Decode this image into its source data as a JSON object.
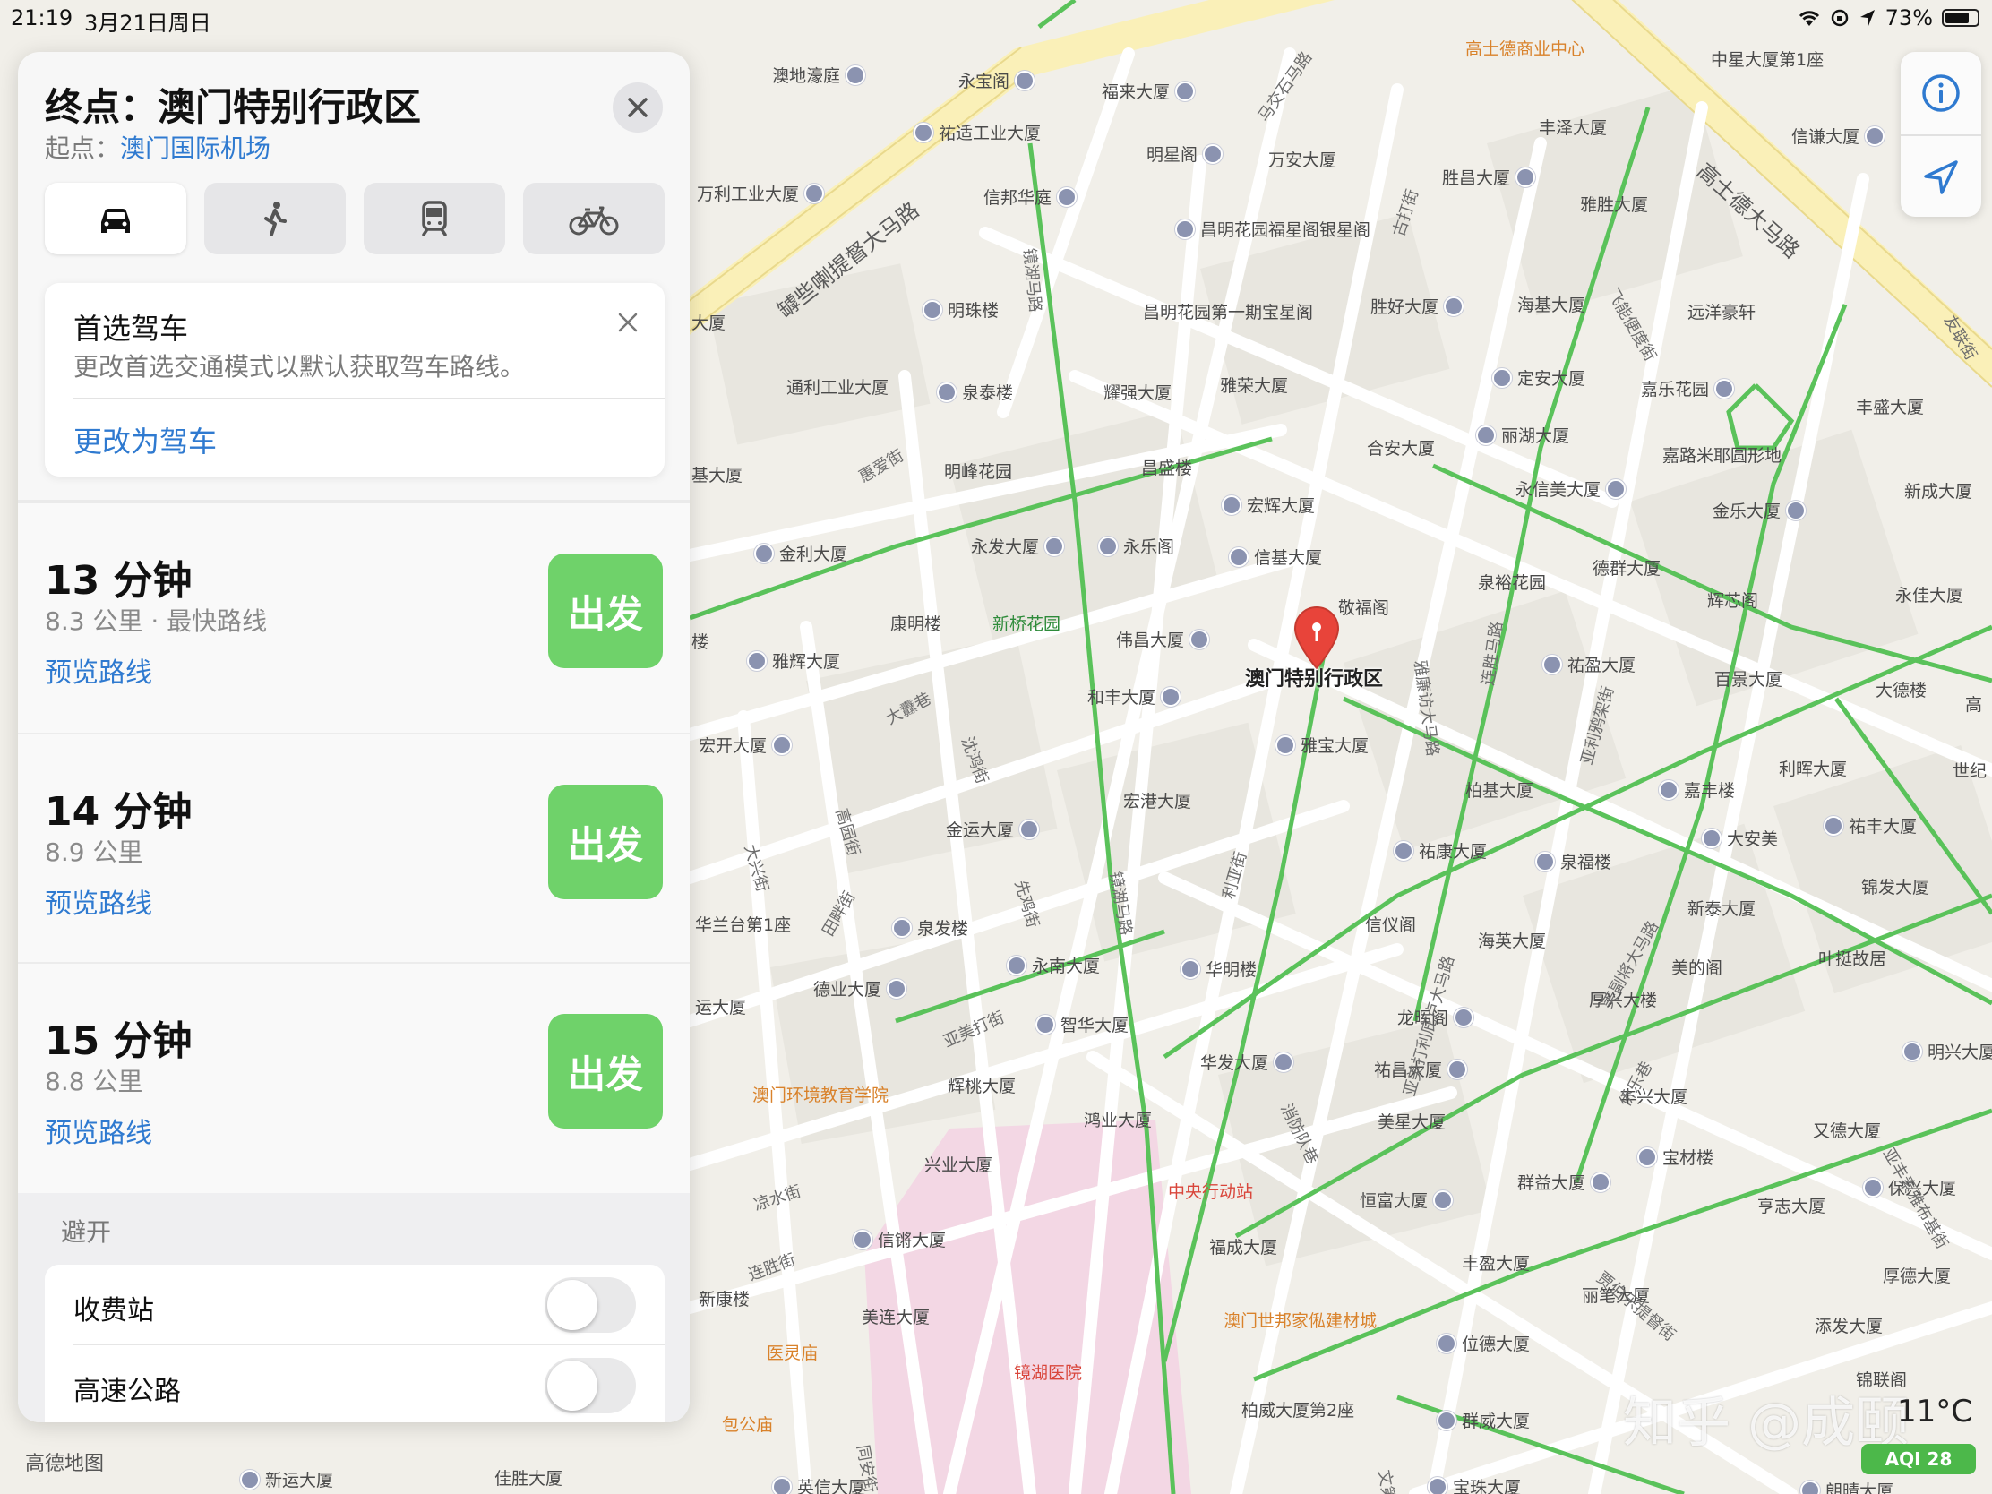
{
  "status_bar": {
    "time": "21:19",
    "date": "3月21日周日",
    "battery": "73%"
  },
  "panel": {
    "title": "终点：澳门特别行政区",
    "origin_prefix": "起点：",
    "origin": "澳门国际机场",
    "modes": [
      {
        "name": "car-icon",
        "active": true
      },
      {
        "name": "walk-icon",
        "active": false
      },
      {
        "name": "transit-icon",
        "active": false
      },
      {
        "name": "bike-icon",
        "active": false
      }
    ],
    "preference": {
      "title": "首选驾车",
      "description": "更改首选交通模式以默认获取驾车路线。",
      "action": "更改为驾车"
    },
    "routes": [
      {
        "minutes": "13 分钟",
        "distance": "8.3 公里 · 最快路线",
        "go": "出发",
        "preview": "预览路线"
      },
      {
        "minutes": "14 分钟",
        "distance": "8.9 公里",
        "go": "出发",
        "preview": "预览路线"
      },
      {
        "minutes": "15 分钟",
        "distance": "8.8 公里",
        "go": "出发",
        "preview": "预览路线"
      }
    ],
    "avoid": {
      "label": "避开",
      "options": [
        {
          "label": "收费站",
          "on": false
        },
        {
          "label": "高速公路",
          "on": false
        }
      ]
    }
  },
  "map": {
    "destination_label": "澳门特别行政区",
    "provider": "高德地图",
    "temperature": "11°C",
    "aqi": "AQI 28",
    "watermark": "知乎 @成颐",
    "pois": [
      {
        "name": "高士德商业中心",
        "kind": "orange"
      },
      {
        "name": "中星大厦第1座",
        "kind": "plain"
      },
      {
        "name": "澳地濠庭",
        "kind": "plain"
      },
      {
        "name": "永宝阁",
        "kind": "plain"
      },
      {
        "name": "福来大厦",
        "kind": "plain"
      },
      {
        "name": "丰泽大厦",
        "kind": "plain"
      },
      {
        "name": "信谦大厦",
        "kind": "plain"
      },
      {
        "name": "祐适工业大厦",
        "kind": "plain"
      },
      {
        "name": "明星阁",
        "kind": "plain"
      },
      {
        "name": "万安大厦",
        "kind": "plain"
      },
      {
        "name": "胜昌大厦",
        "kind": "plain"
      },
      {
        "name": "万利工业大厦",
        "kind": "plain"
      },
      {
        "name": "信邦华庭",
        "kind": "plain"
      },
      {
        "name": "雅胜大厦",
        "kind": "plain"
      },
      {
        "name": "昌明花园福星阁银星阁",
        "kind": "plain"
      },
      {
        "name": "明珠楼",
        "kind": "plain"
      },
      {
        "name": "昌明花园第一期宝星阁",
        "kind": "plain"
      },
      {
        "name": "胜好大厦",
        "kind": "plain"
      },
      {
        "name": "海基大厦",
        "kind": "plain"
      },
      {
        "name": "远洋豪轩",
        "kind": "plain"
      },
      {
        "name": "通利工业大厦",
        "kind": "plain"
      },
      {
        "name": "泉泰楼",
        "kind": "plain"
      },
      {
        "name": "耀强大厦",
        "kind": "plain"
      },
      {
        "name": "雅荣大厦",
        "kind": "plain"
      },
      {
        "name": "定安大厦",
        "kind": "plain"
      },
      {
        "name": "嘉乐花园",
        "kind": "plain"
      },
      {
        "name": "丰盛大厦",
        "kind": "plain"
      },
      {
        "name": "明峰花园",
        "kind": "plain"
      },
      {
        "name": "合安大厦",
        "kind": "plain"
      },
      {
        "name": "丽湖大厦",
        "kind": "plain"
      },
      {
        "name": "嘉路米耶圆形地",
        "kind": "plain"
      },
      {
        "name": "昌盛楼",
        "kind": "plain"
      },
      {
        "name": "永信美大厦",
        "kind": "plain"
      },
      {
        "name": "新成大厦",
        "kind": "plain"
      },
      {
        "name": "宏辉大厦",
        "kind": "plain"
      },
      {
        "name": "金乐大厦",
        "kind": "plain"
      },
      {
        "name": "金利大厦",
        "kind": "plain"
      },
      {
        "name": "永发大厦",
        "kind": "plain"
      },
      {
        "name": "永乐阁",
        "kind": "plain"
      },
      {
        "name": "信基大厦",
        "kind": "plain"
      },
      {
        "name": "德群大厦",
        "kind": "plain"
      },
      {
        "name": "永佳大厦",
        "kind": "plain"
      },
      {
        "name": "康明楼",
        "kind": "plain"
      },
      {
        "name": "新桥花园",
        "kind": "green"
      },
      {
        "name": "敬福阁",
        "kind": "plain"
      },
      {
        "name": "泉裕花园",
        "kind": "plain"
      },
      {
        "name": "辉芯阁",
        "kind": "plain"
      },
      {
        "name": "雅辉大厦",
        "kind": "plain"
      },
      {
        "name": "伟昌大厦",
        "kind": "plain"
      },
      {
        "name": "祐盈大厦",
        "kind": "plain"
      },
      {
        "name": "百景大厦",
        "kind": "plain"
      },
      {
        "name": "大德楼",
        "kind": "plain"
      },
      {
        "name": "和丰大厦",
        "kind": "plain"
      },
      {
        "name": "宏开大厦",
        "kind": "plain"
      },
      {
        "name": "雅宝大厦",
        "kind": "plain"
      },
      {
        "name": "柏基大厦",
        "kind": "plain"
      },
      {
        "name": "嘉丰楼",
        "kind": "plain"
      },
      {
        "name": "利晖大厦",
        "kind": "plain"
      },
      {
        "name": "宏港大厦",
        "kind": "plain"
      },
      {
        "name": "金运大厦",
        "kind": "plain"
      },
      {
        "name": "祐康大厦",
        "kind": "plain"
      },
      {
        "name": "泉福楼",
        "kind": "plain"
      },
      {
        "name": "大安美",
        "kind": "plain"
      },
      {
        "name": "祐丰大厦",
        "kind": "plain"
      },
      {
        "name": "锦发大厦",
        "kind": "plain"
      },
      {
        "name": "信仪阁",
        "kind": "plain"
      },
      {
        "name": "新泰大厦",
        "kind": "plain"
      },
      {
        "name": "海英大厦",
        "kind": "plain"
      },
      {
        "name": "华兰台第1座",
        "kind": "plain"
      },
      {
        "name": "泉发楼",
        "kind": "plain"
      },
      {
        "name": "华明楼",
        "kind": "plain"
      },
      {
        "name": "叶挺故居",
        "kind": "plain"
      },
      {
        "name": "美的阁",
        "kind": "plain"
      },
      {
        "name": "德业大厦",
        "kind": "plain"
      },
      {
        "name": "永南大厦",
        "kind": "plain"
      },
      {
        "name": "厚兴大楼",
        "kind": "plain"
      },
      {
        "name": "智华大厦",
        "kind": "plain"
      },
      {
        "name": "龙晖阁",
        "kind": "plain"
      },
      {
        "name": "明兴大厦",
        "kind": "plain"
      },
      {
        "name": "华发大厦",
        "kind": "plain"
      },
      {
        "name": "祐昌大厦",
        "kind": "plain"
      },
      {
        "name": "澳门环境教育学院",
        "kind": "orange"
      },
      {
        "name": "辉桃大厦",
        "kind": "plain"
      },
      {
        "name": "丰兴大厦",
        "kind": "plain"
      },
      {
        "name": "鸿业大厦",
        "kind": "plain"
      },
      {
        "name": "美星大厦",
        "kind": "plain"
      },
      {
        "name": "又德大厦",
        "kind": "plain"
      },
      {
        "name": "兴业大厦",
        "kind": "plain"
      },
      {
        "name": "宝材楼",
        "kind": "plain"
      },
      {
        "name": "中央行动站",
        "kind": "red"
      },
      {
        "name": "群益大厦",
        "kind": "plain"
      },
      {
        "name": "亨志大厦",
        "kind": "plain"
      },
      {
        "name": "保兴大厦",
        "kind": "plain"
      },
      {
        "name": "恒富大厦",
        "kind": "plain"
      },
      {
        "name": "信锵大厦",
        "kind": "plain"
      },
      {
        "name": "福成大厦",
        "kind": "plain"
      },
      {
        "name": "丰盈大厦",
        "kind": "plain"
      },
      {
        "name": "丽笔大厦",
        "kind": "plain"
      },
      {
        "name": "厚德大厦",
        "kind": "plain"
      },
      {
        "name": "新康楼",
        "kind": "plain"
      },
      {
        "name": "美连大厦",
        "kind": "plain"
      },
      {
        "name": "澳门世邦家俬建材城",
        "kind": "orange"
      },
      {
        "name": "添发大厦",
        "kind": "plain"
      },
      {
        "name": "医灵庙",
        "kind": "orange"
      },
      {
        "name": "镜湖医院",
        "kind": "red"
      },
      {
        "name": "位德大厦",
        "kind": "plain"
      },
      {
        "name": "锦联阁",
        "kind": "plain"
      },
      {
        "name": "包公庙",
        "kind": "orange"
      },
      {
        "name": "柏威大厦第2座",
        "kind": "plain"
      },
      {
        "name": "群威大厦",
        "kind": "plain"
      },
      {
        "name": "新运大厦",
        "kind": "plain"
      },
      {
        "name": "佳胜大厦",
        "kind": "plain"
      },
      {
        "name": "英信大厦",
        "kind": "plain"
      },
      {
        "name": "宝珠大厦",
        "kind": "plain"
      },
      {
        "name": "朗晴大厦",
        "kind": "plain"
      },
      {
        "name": "大厦",
        "kind": "plain"
      },
      {
        "name": "基大厦",
        "kind": "plain"
      },
      {
        "name": "楼",
        "kind": "plain"
      },
      {
        "name": "运大厦",
        "kind": "plain"
      },
      {
        "name": "高",
        "kind": "plain"
      },
      {
        "name": "世纪",
        "kind": "plain"
      }
    ],
    "streets": [
      "罅些喇提督大马路",
      "高士德大马路",
      "镜湖马路",
      "马交石马路",
      "古打街",
      "飞能便度街",
      "友联街",
      "惠爱街",
      "大纛巷",
      "沈鸿街",
      "雅廉访大马路",
      "连胜马路",
      "高园街",
      "大兴街",
      "田畔街",
      "先鸡街",
      "亚美打街",
      "镜湖马路",
      "利亚街",
      "亚利鸦架街",
      "亚美打利庇卢大马路",
      "消防队巷",
      "美副将大马路",
      "侨乐巷",
      "贾伯乐提督街",
      "亚丰素雅布基街",
      "凉水街",
      "连胜街",
      "同安街",
      "文第士街"
    ]
  }
}
